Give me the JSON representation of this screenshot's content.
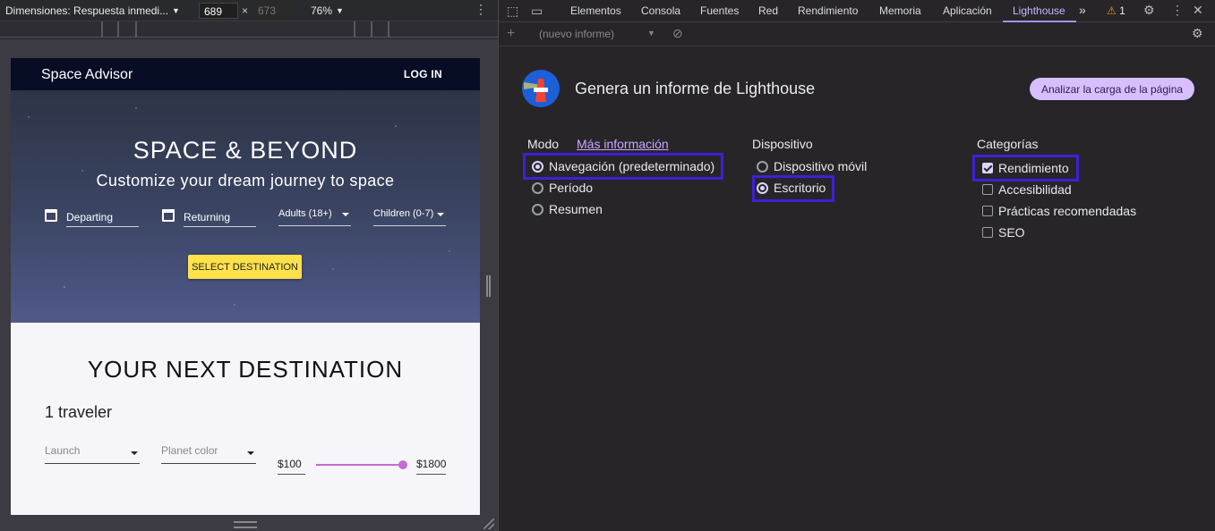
{
  "device_toolbar": {
    "dimensions_label": "Dimensiones: Respuesta inmedi...",
    "width": "689",
    "height": "673",
    "times": "×",
    "zoom": "76%"
  },
  "site": {
    "brand": "Space Advisor",
    "login": "LOG IN",
    "hero_title": "SPACE & BEYOND",
    "hero_subtitle": "Customize your dream journey to space",
    "departing": "Departing",
    "returning": "Returning",
    "adults": "Adults (18+)",
    "children": "Children (0-7)",
    "select_destination": "SELECT DESTINATION",
    "section_title": "YOUR NEXT DESTINATION",
    "traveler": "1 traveler",
    "launch": "Launch",
    "planet_color": "Planet color",
    "price_min": "$100",
    "price_max": "$1800"
  },
  "devtools": {
    "tabs": [
      "Elementos",
      "Consola",
      "Fuentes",
      "Red",
      "Rendimiento",
      "Memoria",
      "Aplicación",
      "Lighthouse"
    ],
    "more_tabs": "»",
    "warnings_count": "1",
    "new_report": "(nuevo informe)",
    "lighthouse": {
      "title": "Genera un informe de Lighthouse",
      "analyze_button": "Analizar la carga de la página",
      "mode_title": "Modo",
      "more_info": "Más información",
      "modes": [
        "Navegación (predeterminado)",
        "Período",
        "Resumen"
      ],
      "device_title": "Dispositivo",
      "devices": [
        "Dispositivo móvil",
        "Escritorio"
      ],
      "categories_title": "Categorías",
      "categories": [
        "Rendimiento",
        "Accesibilidad",
        "Prácticas recomendadas",
        "SEO"
      ]
    }
  },
  "colors": {
    "accent": "#c8b6ff",
    "highlight": "#3f1fd6",
    "cta_yellow": "#ffe14b",
    "slider": "#c56ad3"
  }
}
